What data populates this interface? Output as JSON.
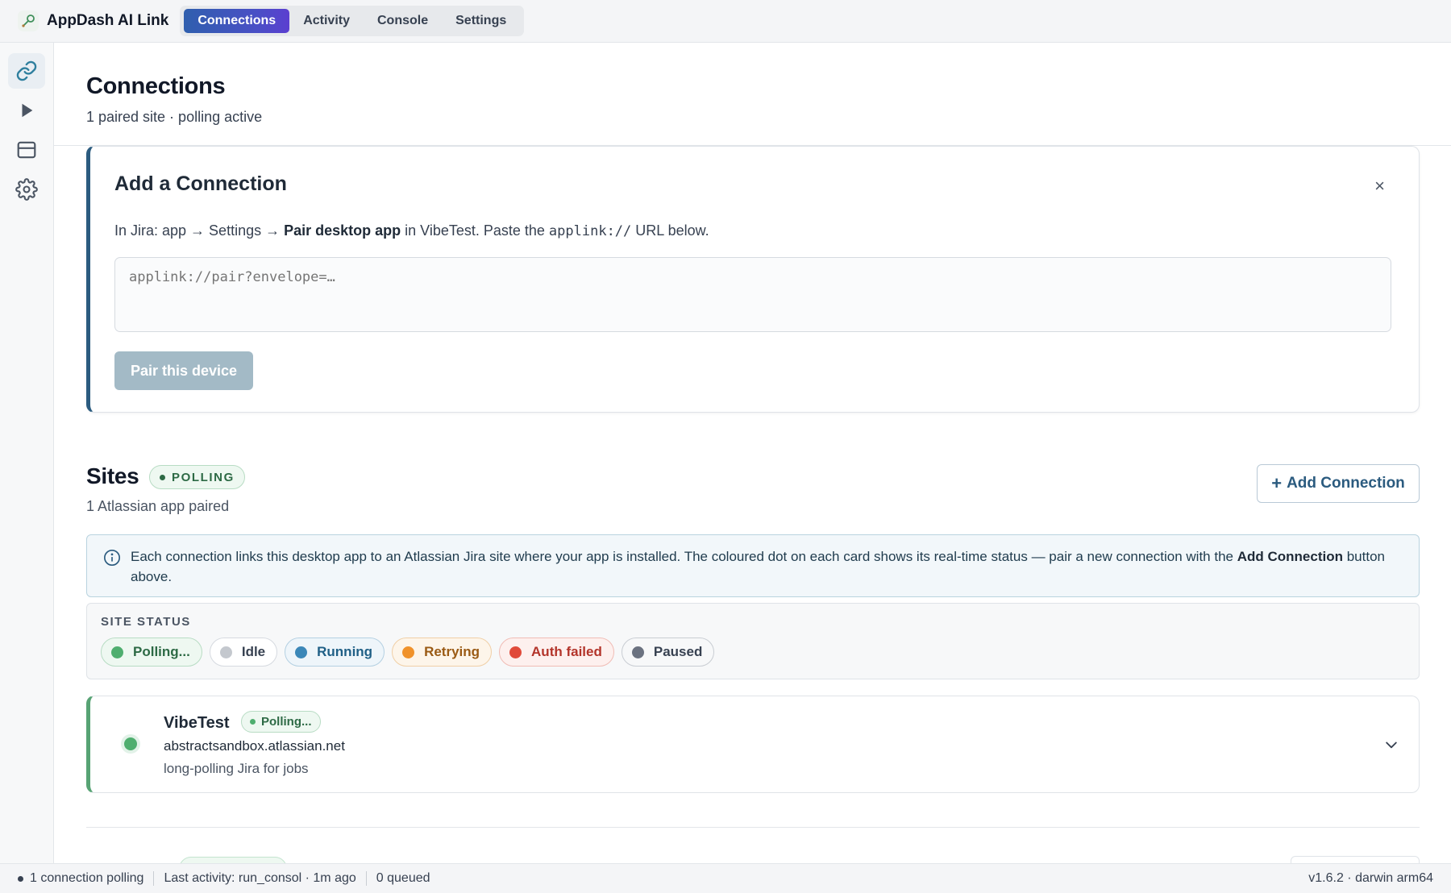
{
  "app": {
    "title": "AppDash AI Link"
  },
  "tabs": [
    {
      "label": "Connections",
      "active": true
    },
    {
      "label": "Activity",
      "active": false
    },
    {
      "label": "Console",
      "active": false
    },
    {
      "label": "Settings",
      "active": false
    }
  ],
  "rail": [
    {
      "icon": "link-icon",
      "active": true
    },
    {
      "icon": "play-icon",
      "active": false
    },
    {
      "icon": "panel-icon",
      "active": false
    },
    {
      "icon": "gear-icon",
      "active": false
    }
  ],
  "page": {
    "title": "Connections",
    "subtitle": "1 paired site · polling active"
  },
  "add_connection": {
    "title": "Add a Connection",
    "close_label": "×",
    "instr_prefix": "In Jira: app → Settings → ",
    "instr_bold": "Pair desktop app",
    "instr_mid": " in VibeTest. Paste the ",
    "instr_code": "applink://",
    "instr_suffix": " URL below.",
    "input_value": "",
    "input_placeholder": "applink://pair?envelope=…",
    "button_label": "Pair this device"
  },
  "sites": {
    "title": "Sites",
    "badge": "POLLING",
    "subtitle": "1 Atlassian app paired",
    "add_button_plus": "+",
    "add_button_label": "Add Connection",
    "info_text_prefix": "Each connection links this desktop app to an Atlassian Jira site where your app is installed. The coloured dot on each card shows its real-time status — pair a new connection with the ",
    "info_text_bold": "Add Connection",
    "info_text_suffix": " button above."
  },
  "site_status": {
    "label": "SITE STATUS",
    "chips": [
      {
        "label": "Polling...",
        "dot": "#4fae6f",
        "text": "#2d6a45",
        "border": "#b8dcc4",
        "bg": "#eef8f1"
      },
      {
        "label": "Idle",
        "dot": "#c4c8ce",
        "text": "#374151",
        "border": "#d6dae0",
        "bg": "#ffffff"
      },
      {
        "label": "Running",
        "dot": "#3b87b8",
        "text": "#1f5f86",
        "border": "#b4d0e2",
        "bg": "#eef5fa"
      },
      {
        "label": "Retrying",
        "dot": "#f0922b",
        "text": "#9a5a14",
        "border": "#f0cfa6",
        "bg": "#fdf5ea"
      },
      {
        "label": "Auth failed",
        "dot": "#e04a3a",
        "text": "#b3342a",
        "border": "#f0bcb5",
        "bg": "#fdf0ee"
      },
      {
        "label": "Paused",
        "dot": "#6b7280",
        "text": "#374151",
        "border": "#c9cdd3",
        "bg": "#f7f8f9"
      }
    ]
  },
  "site_card": {
    "name": "VibeTest",
    "badge": "Polling...",
    "host": "abstractsandbox.atlassian.net",
    "description": "long-polling Jira for jobs"
  },
  "statusbar": {
    "polling": "1 connection polling",
    "last_activity": "Last activity: run_consol · 1m ago",
    "queued": "0 queued",
    "version": "v1.6.2 · darwin arm64"
  }
}
